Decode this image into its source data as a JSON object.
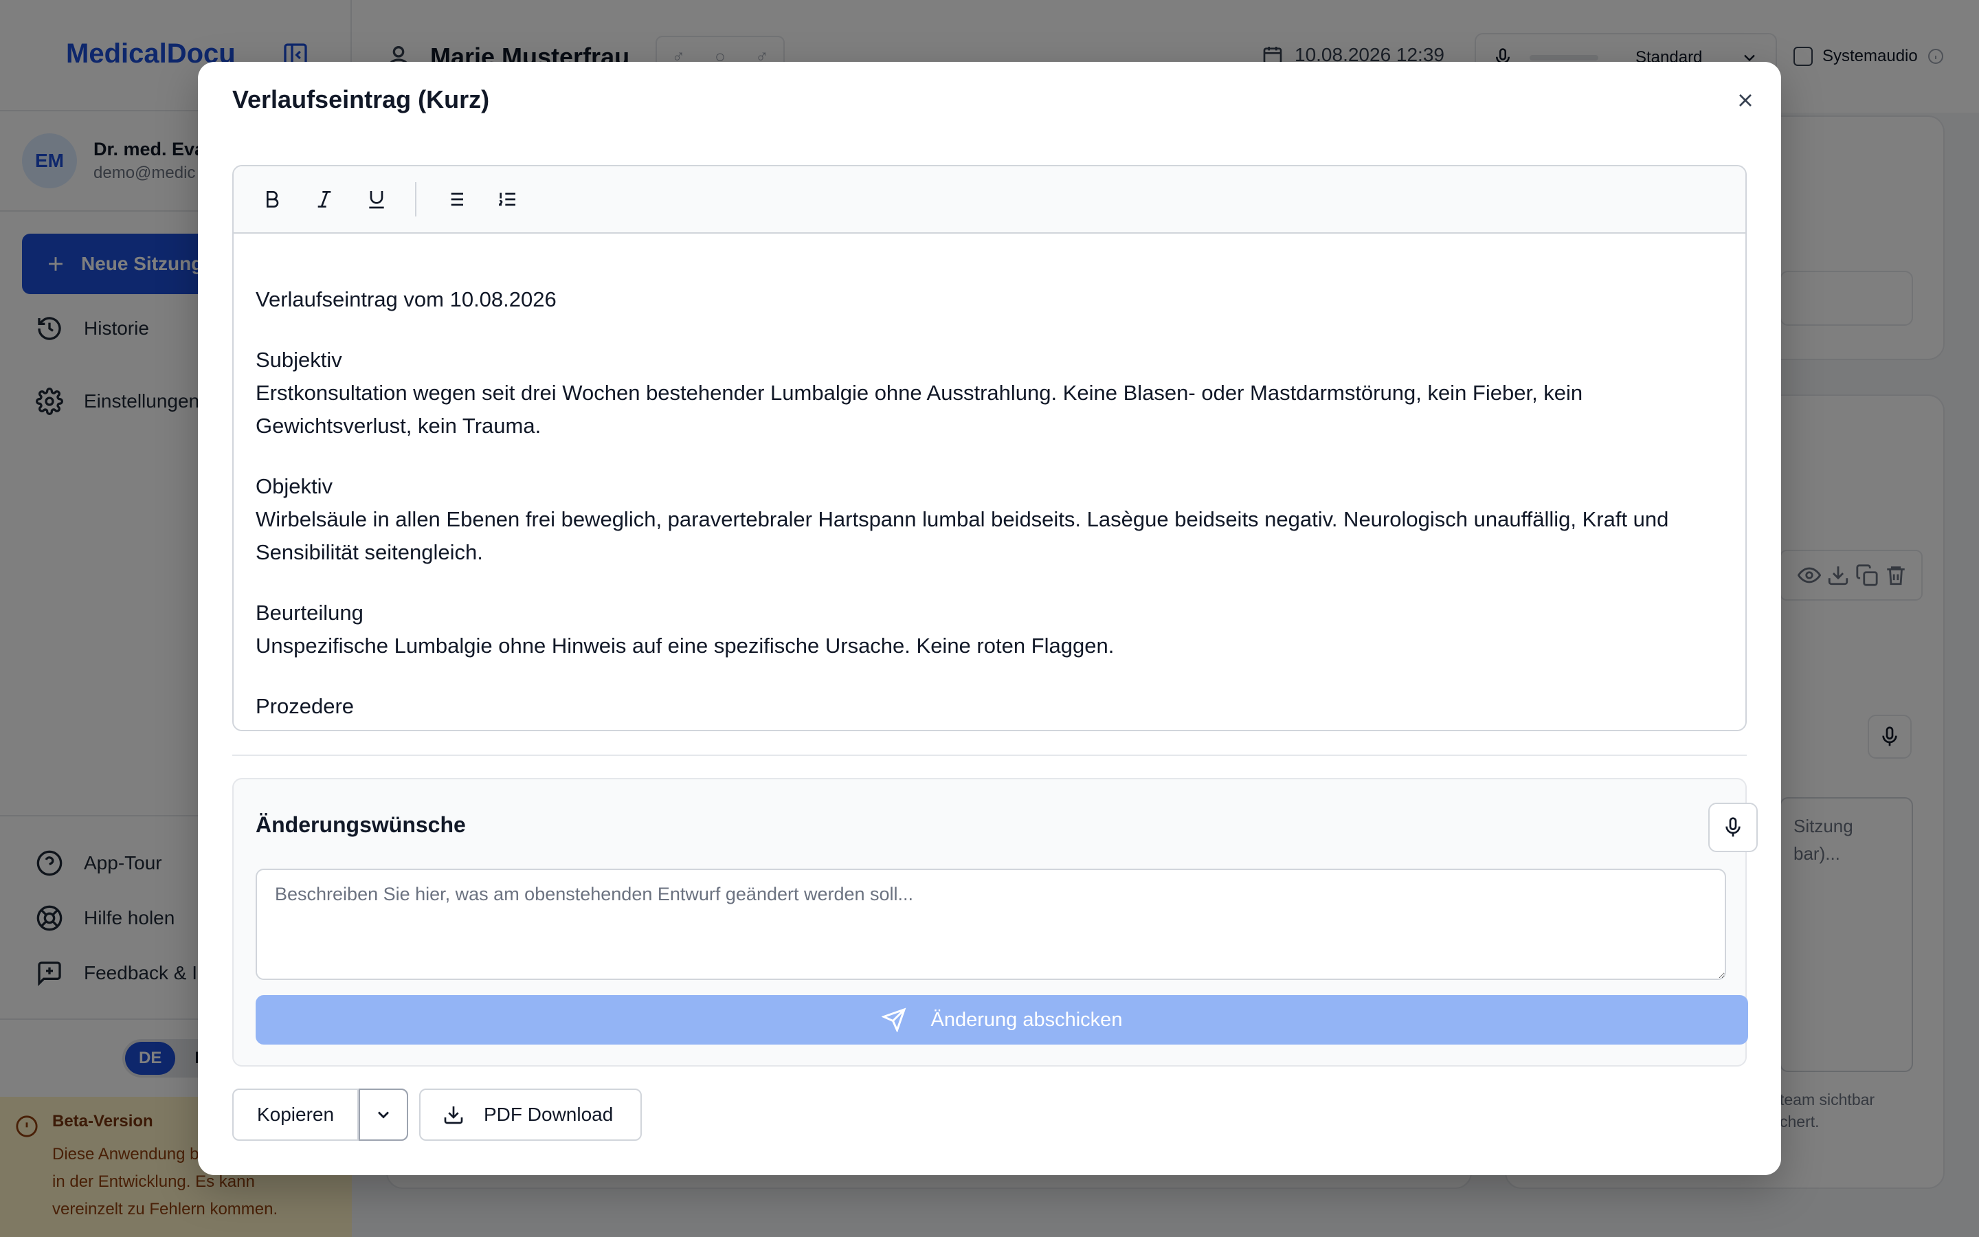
{
  "app": {
    "logo": "MedicalDocu",
    "user": {
      "initials": "EM",
      "name": "Dr. med. Eva",
      "email": "demo@medic"
    },
    "new_session": "Neue Sitzung",
    "nav": {
      "history": "Historie",
      "settings": "Einstellungen"
    },
    "bottom_nav": {
      "tour": "App-Tour",
      "help": "Hilfe holen",
      "feedback": "Feedback & I"
    },
    "languages": [
      "DE",
      "E"
    ],
    "beta": {
      "title": "Beta-Version",
      "text_1": "Diese Anwendung b",
      "text_2": "in der Entwicklung. Es kann",
      "text_3": "vereinzelt zu Fehlern kommen."
    },
    "patient_name": "Marie Musterfrau",
    "datetime": "10.08.2026 12:39",
    "mic_mode": "Standard",
    "system_audio": "Systemaudio",
    "bg_textarea_1": "Sitzung",
    "bg_textarea_2": "bar)...",
    "bg_note_1": "team sichtbar",
    "bg_note_2": "chert."
  },
  "modal": {
    "title": "Verlaufseintrag (Kurz)",
    "content": {
      "heading": "Verlaufseintrag vom 10.08.2026",
      "sections": [
        {
          "title": "Subjektiv",
          "text": "Erstkonsultation wegen seit drei Wochen bestehender Lumbalgie ohne Ausstrahlung. Keine Blasen- oder Mastdarmstörung, kein Fieber, kein Gewichtsverlust, kein Trauma."
        },
        {
          "title": "Objektiv",
          "text": "Wirbelsäule in allen Ebenen frei beweglich, paravertebraler Hartspann lumbal beidseits. Lasègue beidseits negativ. Neurologisch unauffällig, Kraft und Sensibilität seitengleich."
        },
        {
          "title": "Beurteilung",
          "text": "Unspezifische Lumbalgie ohne Hinweis auf eine spezifische Ursache. Keine roten Flaggen."
        },
        {
          "title": "Prozedere",
          "text": ""
        }
      ]
    },
    "changes": {
      "title": "Änderungswünsche",
      "placeholder": "Beschreiben Sie hier, was am obenstehenden Entwurf geändert werden soll...",
      "value": "",
      "submit_label": "Änderung abschicken"
    },
    "footer": {
      "copy_label": "Kopieren",
      "pdf_label": "PDF Download"
    }
  }
}
